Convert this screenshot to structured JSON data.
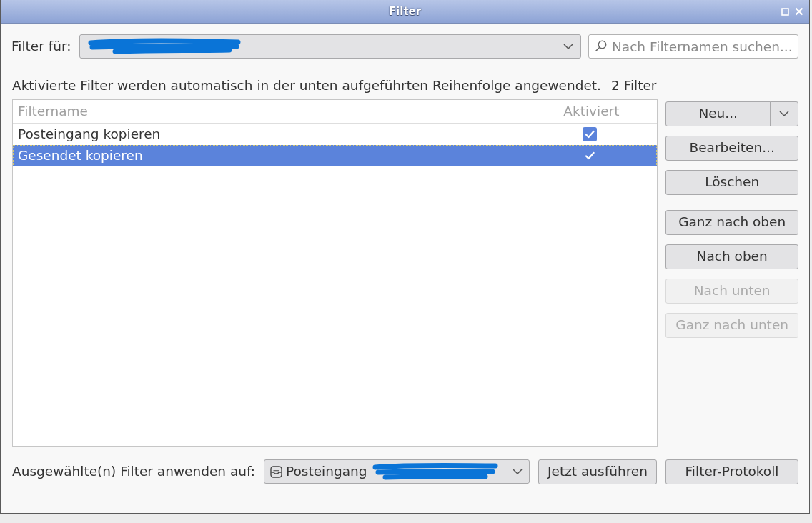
{
  "window": {
    "title": "Filter"
  },
  "filter_for": {
    "label": "Filter für:"
  },
  "search": {
    "placeholder": "Nach Filternamen suchen..."
  },
  "summary": {
    "text": "Aktivierte Filter werden automatisch in der unten aufgeführten Reihenfolge angewendet.",
    "count": "2 Filter"
  },
  "filter_list": {
    "columns": [
      "Filtername",
      "Aktiviert"
    ],
    "rows": [
      {
        "name": "Posteingang kopieren",
        "checked": true,
        "selected": false
      },
      {
        "name": "Gesendet kopieren",
        "checked": true,
        "selected": true
      }
    ]
  },
  "edit_buttons": [
    {
      "label": "Neu...",
      "kind": "split",
      "disabled": false
    },
    {
      "label": "Bearbeiten...",
      "kind": "plain",
      "disabled": false
    },
    {
      "label": "Löschen",
      "kind": "plain",
      "disabled": false
    }
  ],
  "move_buttons": [
    {
      "label": "Ganz nach oben",
      "disabled": false
    },
    {
      "label": "Nach oben",
      "disabled": false
    },
    {
      "label": "Nach unten",
      "disabled": true
    },
    {
      "label": "Ganz nach unten",
      "disabled": true
    }
  ],
  "apply": {
    "label": "Ausgewählte(n) Filter anwenden auf:",
    "folder": "Posteingang"
  },
  "bottom_buttons": [
    {
      "label": "Jetzt ausführen"
    },
    {
      "label": "Filter-Protokoll"
    }
  ]
}
